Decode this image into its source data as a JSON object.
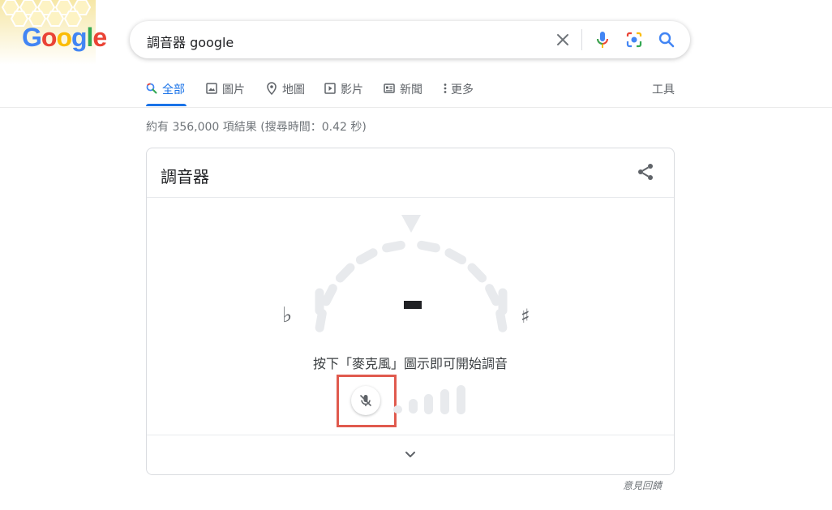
{
  "logo": {
    "text": "Google"
  },
  "search": {
    "query": "調音器 google"
  },
  "tabs": [
    {
      "label": "全部",
      "icon": "search-icon",
      "active": true
    },
    {
      "label": "圖片",
      "icon": "image-icon"
    },
    {
      "label": "地圖",
      "icon": "map-pin-icon"
    },
    {
      "label": "影片",
      "icon": "play-icon"
    },
    {
      "label": "新聞",
      "icon": "newspaper-icon"
    },
    {
      "label": "更多",
      "icon": "more-vertical-icon"
    }
  ],
  "tools_label": "工具",
  "result_stats": "約有 356,000 項結果 (搜尋時間：0.42 秒)",
  "tuner": {
    "title": "調音器",
    "flat_symbol": "♭",
    "sharp_symbol": "♯",
    "instruction": "按下「麥克風」圖示即可開始調音",
    "mic_state": "off"
  },
  "feedback_label": "意見回饋",
  "colors": {
    "accent": "#1a73e8",
    "highlight": "#e05a4e",
    "dial": "#e8eaed"
  }
}
